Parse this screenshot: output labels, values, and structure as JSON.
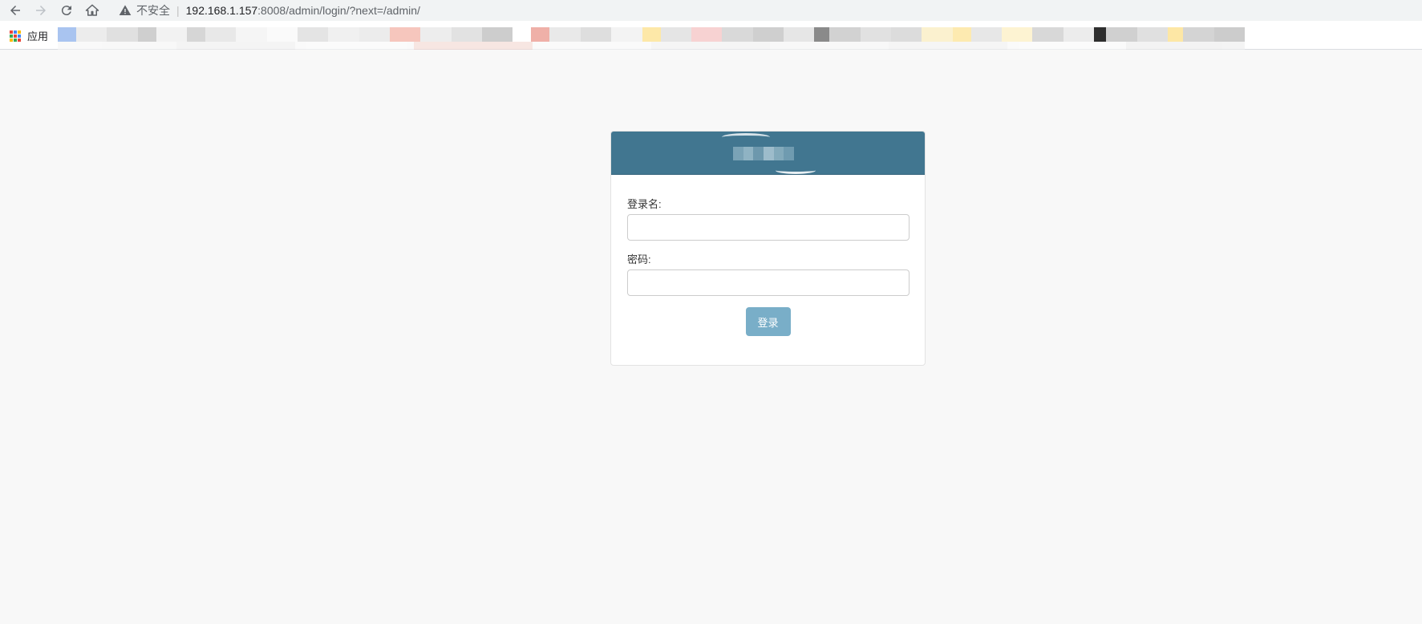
{
  "browser": {
    "security_label": "不安全",
    "url_host": "192.168.1.157",
    "url_path": ":8008/admin/login/?next=/admin/",
    "icons": [
      "back-icon",
      "forward-icon",
      "reload-icon",
      "home-icon",
      "warning-icon",
      "apps-icon"
    ]
  },
  "bookmarks": {
    "apps_label": "应用"
  },
  "login": {
    "username_label": "登录名:",
    "password_label": "密码:",
    "submit_label": "登录",
    "username_value": "",
    "password_value": ""
  },
  "colors": {
    "header": "#417690",
    "button": "#79aec8",
    "page_bg": "#f8f8f8"
  }
}
